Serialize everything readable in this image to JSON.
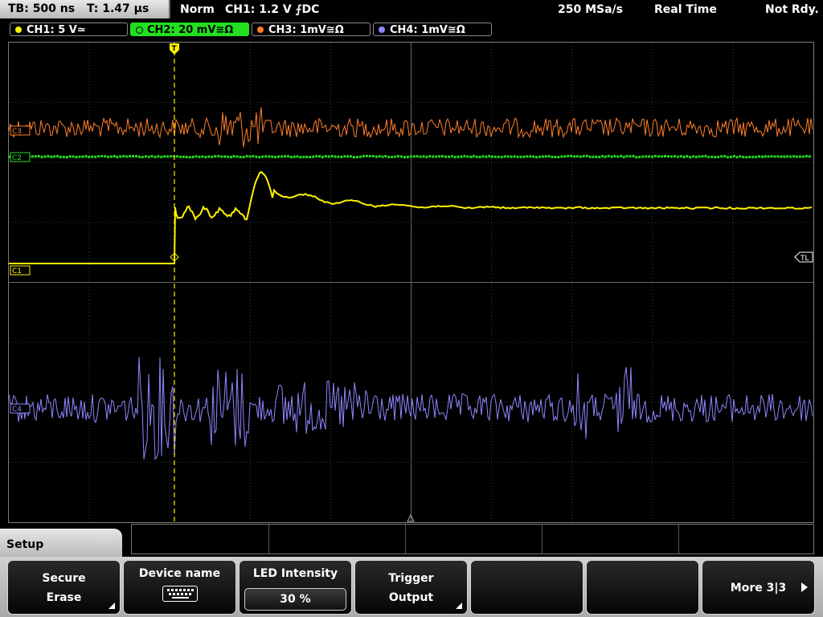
{
  "status": {
    "timebase": "TB: 500 ns",
    "trigger_time": "T: 1.47 µs",
    "mode": "Norm",
    "trigger_info": "CH1: 1.2 V ⨍DC",
    "sample_rate": "250 MSa/s",
    "acq_mode": "Real Time",
    "state": "Not Rdy."
  },
  "channels": [
    {
      "label": "CH1: 5 V≃",
      "color": "#fff200"
    },
    {
      "label": "CH2: 20 mV≅Ω",
      "color": "#22e01f",
      "active": true
    },
    {
      "label": "CH3: 1mV≅Ω",
      "color": "#ff7f2a"
    },
    {
      "label": "CH4: 1mV≅Ω",
      "color": "#8e87ff"
    }
  ],
  "markers": {
    "ch1": "C1",
    "ch2": "C2",
    "ch3": "C3",
    "ch4": "C4",
    "trigger_level": "TL",
    "trigger_pos": "T"
  },
  "menu": {
    "title": "Setup",
    "softkeys": {
      "secure_erase": [
        "Secure",
        "Erase"
      ],
      "device_name": "Device name",
      "led_intensity": "LED Intensity",
      "led_value": "30 %",
      "trigger_output": [
        "Trigger",
        "Output"
      ],
      "more": "More 3|3"
    }
  },
  "icons": [
    "keyboard-icon",
    "submenu-corner-icon",
    "more-arrow-icon",
    "trigger-marker-icon"
  ]
}
